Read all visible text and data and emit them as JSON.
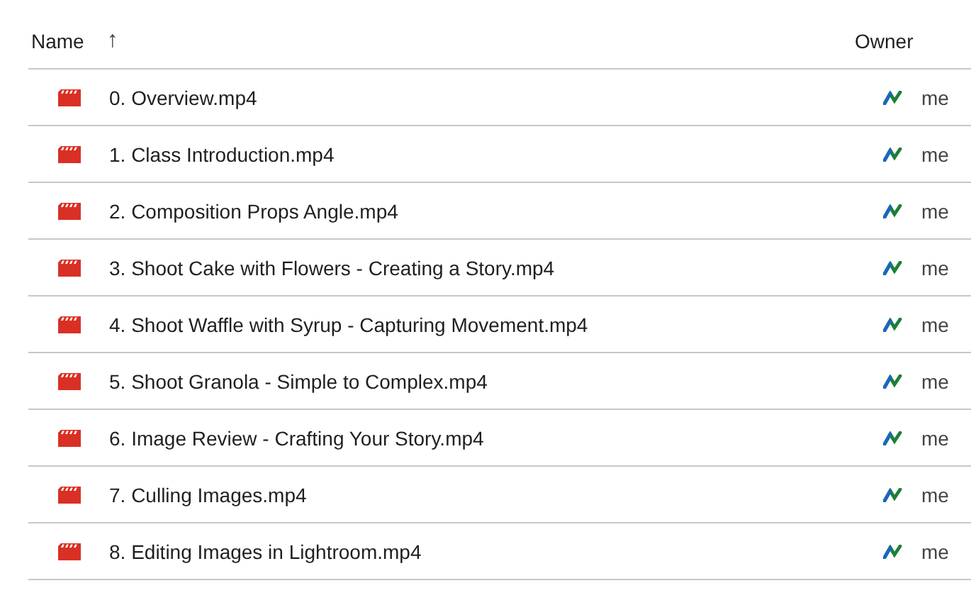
{
  "columns": {
    "name": "Name",
    "sort_arrow": "↑",
    "owner": "Owner"
  },
  "files": [
    {
      "name": "0. Overview.mp4",
      "owner": "me"
    },
    {
      "name": "1. Class Introduction.mp4",
      "owner": "me"
    },
    {
      "name": "2. Composition Props Angle.mp4",
      "owner": "me"
    },
    {
      "name": "3. Shoot Cake with Flowers - Creating a Story.mp4",
      "owner": "me"
    },
    {
      "name": "4. Shoot Waffle with Syrup - Capturing Movement.mp4",
      "owner": "me"
    },
    {
      "name": "5. Shoot Granola - Simple to Complex.mp4",
      "owner": "me"
    },
    {
      "name": "6. Image Review - Crafting Your Story.mp4",
      "owner": "me"
    },
    {
      "name": "7. Culling Images.mp4",
      "owner": "me"
    },
    {
      "name": "8. Editing Images in Lightroom.mp4",
      "owner": "me"
    }
  ]
}
